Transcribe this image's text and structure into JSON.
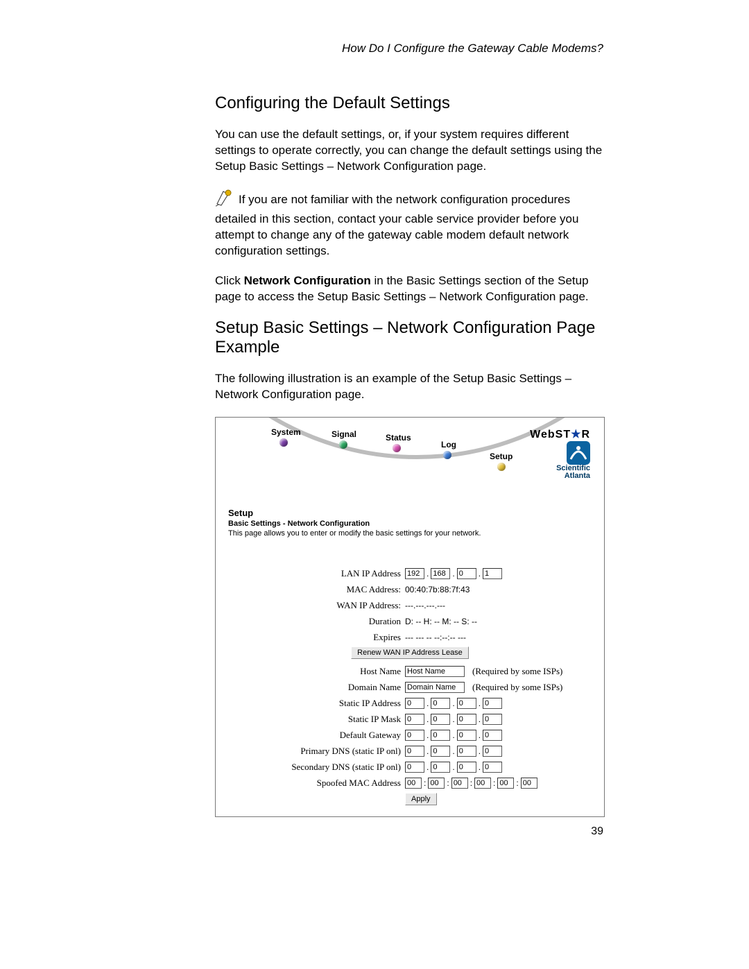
{
  "running_head": "How Do I Configure the Gateway Cable Modems?",
  "heading1": "Configuring the Default Settings",
  "para1": "You can use the default settings, or, if your system requires different settings to operate correctly, you can change the default settings using the Setup Basic Settings – Network Configuration page.",
  "note": "If you are not familiar with the network configuration procedures detailed in this section, contact your cable service provider before you attempt to change any of the gateway cable modem default network configuration settings.",
  "click_pre": "Click ",
  "click_bold": "Network Configuration",
  "click_post": " in the Basic Settings section of the Setup page to access the Setup Basic Settings – Network Configuration page.",
  "heading2": "Setup Basic Settings – Network Configuration Page Example",
  "para2": "The following illustration is an example of the Setup Basic Settings – Network Configuration page.",
  "page_number": "39",
  "shot": {
    "tabs": {
      "system": "System",
      "signal": "Signal",
      "status": "Status",
      "log": "Log",
      "setup": "Setup"
    },
    "brand_web": "WebST",
    "brand_web2": "R",
    "brand_sa1": "Scientific",
    "brand_sa2": "Atlanta",
    "setup_h": "Setup",
    "setup_sub": "Basic Settings - Network Configuration",
    "setup_desc": "This page allows you to enter or modify the basic settings for your network.",
    "labels": {
      "lan_ip": "LAN IP Address",
      "mac": "MAC Address:",
      "wan_ip": "WAN IP Address:",
      "duration": "Duration",
      "expires": "Expires",
      "host": "Host Name",
      "domain": "Domain Name",
      "static_ip": "Static IP Address",
      "static_mask": "Static IP Mask",
      "gateway": "Default Gateway",
      "pdns": "Primary DNS (static IP onl)",
      "sdns": "Secondary DNS (static IP onl)",
      "spoof": "Spoofed MAC Address"
    },
    "values": {
      "lan_ip": [
        "192",
        "168",
        "0",
        "1"
      ],
      "mac": "00:40:7b:88:7f:43",
      "wan_ip": "---.---.---.---",
      "duration": "D: -- H: -- M: -- S: --",
      "expires": "--- --- -- --:--:-- ---",
      "host_ph": "Host Name",
      "domain_ph": "Domain Name",
      "zero_ip": [
        "0",
        "0",
        "0",
        "0"
      ],
      "spoof_mac": [
        "00",
        "00",
        "00",
        "00",
        "00",
        "00"
      ],
      "isp_note": "(Required by some ISPs)"
    },
    "buttons": {
      "renew": "Renew WAN IP Address Lease",
      "apply": "Apply"
    }
  }
}
